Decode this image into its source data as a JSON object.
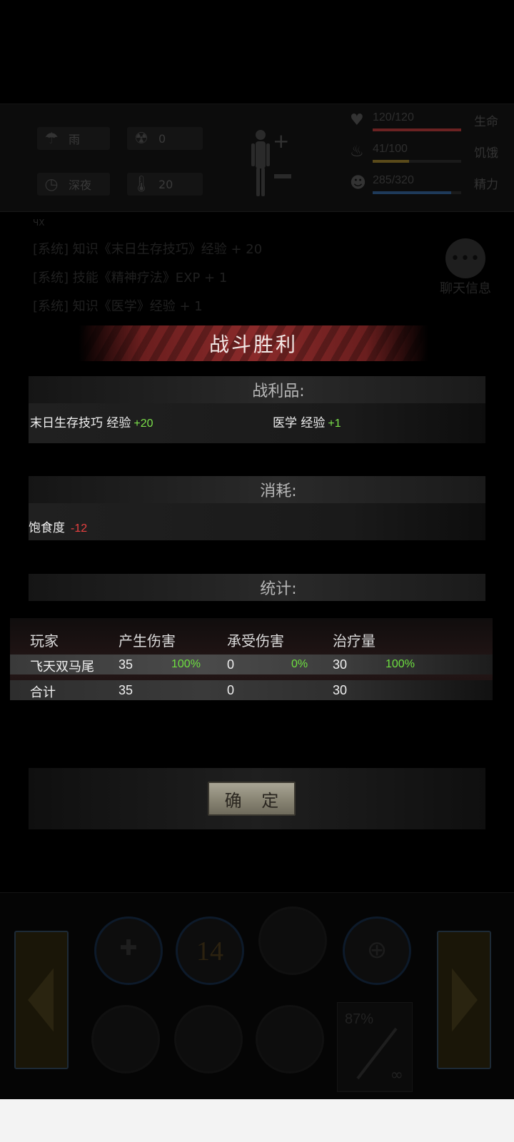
{
  "hud": {
    "weather": "雨",
    "radiation": "0",
    "time_of_day": "深夜",
    "temperature": "20",
    "stats": [
      {
        "label": "生命",
        "value": "120/120",
        "icon": "heart-icon",
        "color": "#6b2222",
        "fill": 1.0
      },
      {
        "label": "饥饿",
        "value": "41/100",
        "icon": "stomach-icon",
        "color": "#5a4a1a",
        "fill": 0.41
      },
      {
        "label": "精力",
        "value": "285/320",
        "icon": "head-icon",
        "color": "#1e3a5a",
        "fill": 0.89
      }
    ]
  },
  "log": {
    "header": "ЧХ",
    "lines": [
      "[系统] 知识《末日生存技巧》经验 + 20",
      "[系统] 技能《精神疗法》EXP + 1",
      "[系统] 知识《医学》经验 + 1"
    ],
    "chat_label": "聊天信息"
  },
  "victory": {
    "title": "战斗胜利",
    "loot_header": "战利品:",
    "loot": [
      {
        "name": "末日生存技巧 经验",
        "amount": "+20"
      },
      {
        "name": "医学 经验",
        "amount": "+1"
      }
    ],
    "cost_header": "消耗:",
    "costs": [
      {
        "name": "饱食度",
        "amount": "-12"
      }
    ],
    "stats_header": "统计:",
    "columns": [
      "玩家",
      "产生伤害",
      "承受伤害",
      "治疗量"
    ],
    "rows": [
      {
        "player": "飞天双马尾",
        "dmg": "35",
        "dmg_pct": "100%",
        "taken": "0",
        "taken_pct": "0%",
        "heal": "30",
        "heal_pct": "100%"
      }
    ],
    "total": {
      "label": "合计",
      "dmg": "35",
      "taken": "0",
      "heal": "30"
    },
    "confirm": "确 定"
  },
  "bottom": {
    "skill_count": "14",
    "weapon_durability": "87%",
    "ammo": "∞"
  }
}
